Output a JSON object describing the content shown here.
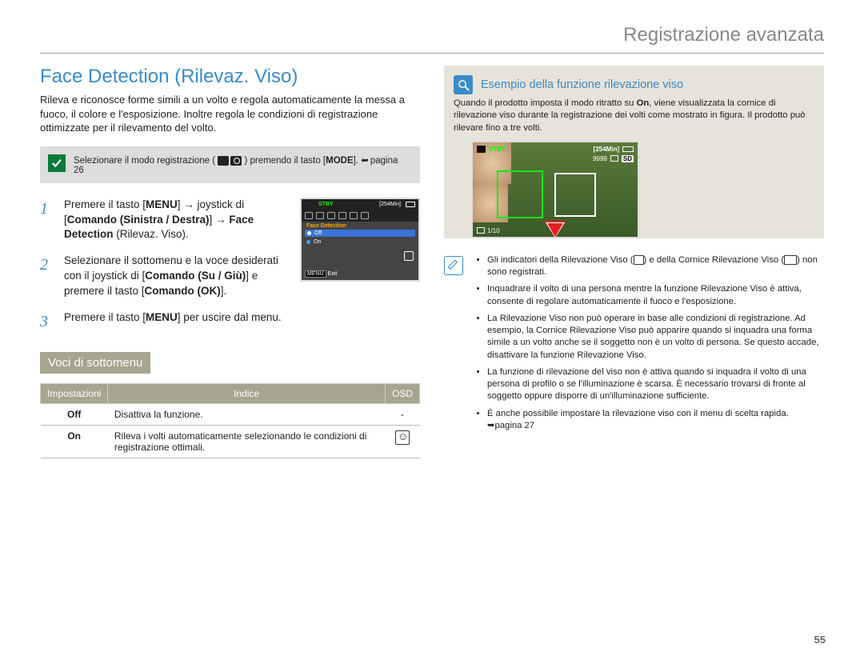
{
  "header": {
    "title": "Registrazione avanzata"
  },
  "left": {
    "section_title": "Face Detection (Rilevaz. Viso)",
    "intro": "Rileva e riconosce forme simili a un volto e regola automaticamente la messa a fuoco, il colore e l'esposizione. Inoltre regola le condizioni di registrazione ottimizzate per il rilevamento del volto.",
    "callout": {
      "prefix": "Selezionare il modo registrazione (",
      "suffix": ") premendo il tasto ",
      "mode_label": "MODE",
      "page_ref": "pagina 26",
      "video_icon": "video-icon",
      "photo_icon": "photo-icon"
    },
    "steps": [
      {
        "num": "1",
        "body_html": "Premere il tasto [<b>MENU</b>] → joystick di [<b>Comando (Sinistra / Destra)</b>] → <b>Face Detection</b> (Rilevaz. Viso)."
      },
      {
        "num": "2",
        "body_html": "Selezionare il sottomenu e la voce desiderati con il joystick di [<b>Comando (Su / Giù)</b>] e premere il tasto [<b>Comando (OK)</b>]."
      },
      {
        "num": "3",
        "body_html": "Premere il tasto [<b>MENU</b>] per uscire dal menu."
      }
    ],
    "menu_screenshot": {
      "stby": "STBY",
      "time": "[254Min]",
      "title": "Face Detection",
      "items": [
        "Off",
        "On"
      ],
      "selected": "Off",
      "exit_btn": "MENU",
      "exit_label": "Exit"
    },
    "submenu_header": "Voci di sottomenu",
    "table": {
      "cols": [
        "Impostazioni",
        "Indice",
        "OSD"
      ],
      "rows": [
        {
          "setting": "Off",
          "index": "Disattiva la funzione.",
          "osd": "-"
        },
        {
          "setting": "On",
          "index": "Rileva i volti automaticamente selezionando le condizioni di registrazione ottimali.",
          "osd": "face-icon"
        }
      ]
    }
  },
  "right": {
    "example": {
      "title": "Esempio della funzione rilevazione viso",
      "text_pre": "Quando il prodotto imposta il modo ritratto su ",
      "text_on": "On",
      "text_post": ", viene visualizzata la cornice di rilevazione viso durante la registrazione dei volti come mostrato in figura. Il prodotto può rilevare fino a tre volti.",
      "screenshot": {
        "stby": "STBY",
        "time_head": "[254Min]",
        "count": "9999",
        "sd": "SD",
        "bottom_label": "1/10"
      }
    },
    "tips": [
      "Gli indicatori della Rilevazione Viso ( face ) e della Cornice Rilevazione Viso ( frame ) non sono registrati.",
      "Inquadrare il volto di una persona mentre la funzione Rilevazione Viso è attiva, consente di regolare automaticamente il fuoco e l'esposizione.",
      "La Rilevazione Viso non può operare in base alle condizioni di registrazione. Ad esempio, la Cornice Rilevazione Viso può apparire quando si inquadra una forma simile a un volto anche se il soggetto non è un volto di persona. Se questo accade, disattivare la funzione Rilevazione Viso.",
      "La funzione di rilevazione del viso non è attiva quando si inquadra il volto di una persona di profilo o se l'illuminazione è scarsa. È necessario trovarsi di fronte al soggetto oppure disporre di un'illuminazione sufficiente.",
      "È anche possibile impostare la rilevazione viso con il menu di scelta rapida. ➥pagina 27"
    ],
    "tip1_parts": {
      "a": "Gli indicatori della Rilevazione Viso (",
      "b": ") e della Cornice Rilevazione Viso (",
      "c": ") non sono registrati."
    }
  },
  "page_number": "55"
}
